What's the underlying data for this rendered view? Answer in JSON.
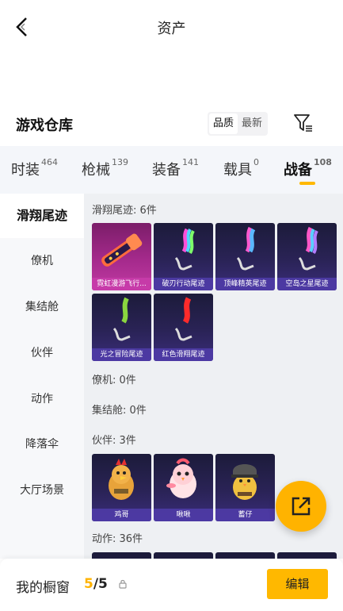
{
  "header": {
    "title": "资产"
  },
  "section": {
    "title": "游戏仓库",
    "sort_options": [
      "品质",
      "最新"
    ]
  },
  "tabs": [
    {
      "label": "时装",
      "count": "464"
    },
    {
      "label": "枪械",
      "count": "139"
    },
    {
      "label": "装备",
      "count": "141"
    },
    {
      "label": "载具",
      "count": "0"
    },
    {
      "label": "战备",
      "count": "108"
    }
  ],
  "categories": [
    "滑翔尾迹",
    "僚机",
    "集结舱",
    "伙伴",
    "动作",
    "降落伞",
    "大厅场景"
  ],
  "groups": {
    "trail": {
      "label": "滑翔尾迹: 6件",
      "items": [
        "霓虹漫游飞行...",
        "破刃行动尾迹",
        "顶峰精英尾迹",
        "空岛之星尾迹",
        "光之冒险尾迹",
        "红色滑翔尾迹"
      ]
    },
    "wingman": {
      "label": "僚机: 0件"
    },
    "capsule": {
      "label": "集结舱: 0件"
    },
    "partner": {
      "label": "伙伴: 3件",
      "items": [
        "鸡哥",
        "啾啾",
        "蓄仔"
      ]
    },
    "emote": {
      "label": "动作: 36件"
    }
  },
  "bottom": {
    "window_label": "我的橱窗",
    "current": "5",
    "total": "/5",
    "edit_label": "编辑"
  },
  "colors": {
    "accent": "#ffb800",
    "card_bg": "#2a2356",
    "card_pink": "#a52a8c"
  },
  "icons": [
    "back-arrow-icon",
    "filter-icon",
    "share-icon",
    "lock-icon"
  ]
}
